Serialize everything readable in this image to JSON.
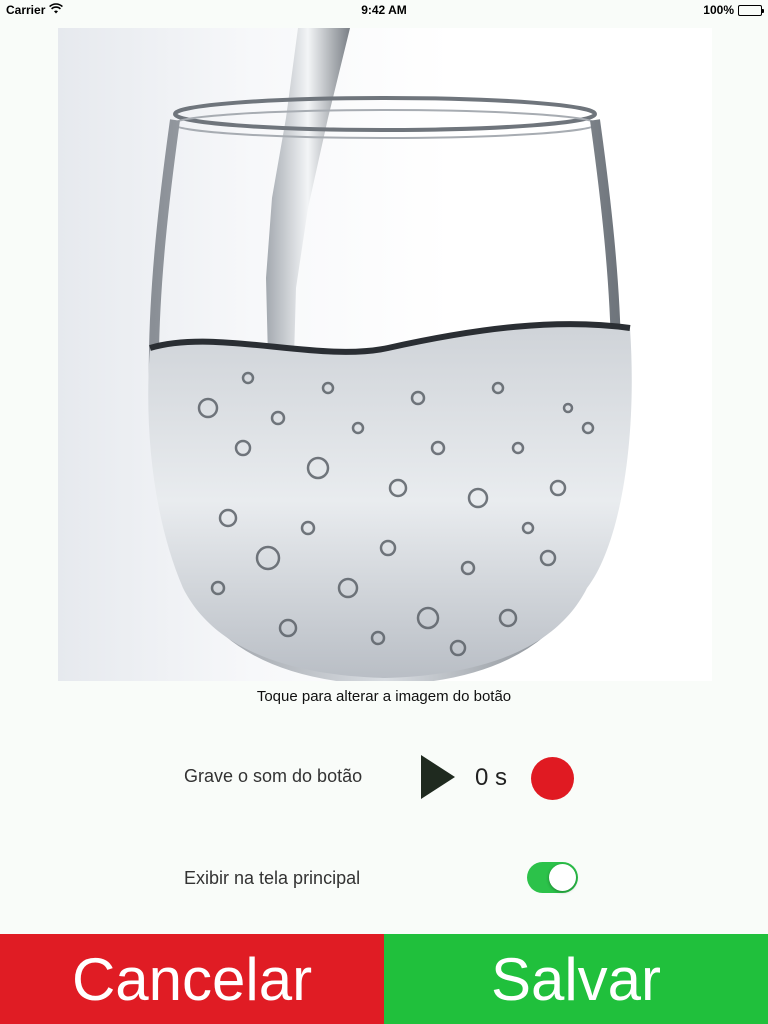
{
  "status_bar": {
    "carrier": "Carrier",
    "time": "9:42 AM",
    "battery": "100%",
    "battery_level": 1.0
  },
  "button_image": {
    "icon": "water-glass-photo"
  },
  "hint": "Toque para alterar a imagem do botão",
  "sound": {
    "label": "Grave o som do botão",
    "duration": "0 s",
    "play_icon": "play-icon",
    "record_icon": "record-icon"
  },
  "show_main": {
    "label": "Exibir na tela principal",
    "enabled": true
  },
  "actions": {
    "cancel": "Cancelar",
    "save": "Salvar"
  },
  "colors": {
    "cancel": "#e01c24",
    "save": "#20c03c",
    "record": "#e01a22",
    "toggle_on": "#2cc24a",
    "play": "#1f2a1f"
  }
}
